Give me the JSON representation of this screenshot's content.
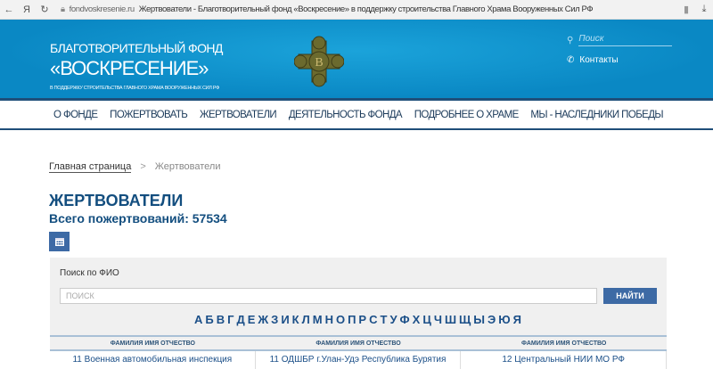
{
  "browser": {
    "back": "←",
    "ya": "Я",
    "reload": "↻",
    "domain": "fondvoskresenie.ru",
    "title": "Жертвователи - Благотворительный фонд «Воскресение» в поддержку строительства Главного Храма Вооруженных Сил РФ"
  },
  "header": {
    "line1": "БЛАГОТВОРИТЕЛЬНЫЙ ФОНД",
    "line2": "«ВОСКРЕСЕНИЕ»",
    "line3": "В ПОДДЕРЖКУ СТРОИТЕЛЬСТВА ГЛАВНОГО ХРАМА ВООРУЖЕННЫХ СИЛ РФ",
    "emblem_letter": "В",
    "search_placeholder": "Поиск",
    "contacts": "Контакты"
  },
  "nav": [
    "О ФОНДЕ",
    "ПОЖЕРТВОВАТЬ",
    "ЖЕРТВОВАТЕЛИ",
    "ДЕЯТЕЛЬНОСТЬ ФОНДА",
    "ПОДРОБНЕЕ О ХРАМЕ",
    "МЫ - НАСЛЕДНИКИ ПОБЕДЫ"
  ],
  "breadcrumb": {
    "home": "Главная страница",
    "sep": ">",
    "current": "Жертвователи"
  },
  "page": {
    "title": "ЖЕРТВОВАТЕЛИ",
    "total": "Всего пожертвований: 57534"
  },
  "search": {
    "label": "Поиск по ФИО",
    "placeholder": "ПОИСК",
    "button": "НАЙТИ"
  },
  "letters": [
    "А",
    "Б",
    "В",
    "Г",
    "Д",
    "Е",
    "Ж",
    "З",
    "И",
    "К",
    "Л",
    "М",
    "Н",
    "О",
    "П",
    "Р",
    "С",
    "Т",
    "У",
    "Ф",
    "Х",
    "Ц",
    "Ч",
    "Ш",
    "Щ",
    "Ы",
    "Э",
    "Ю",
    "Я"
  ],
  "table": {
    "headers": [
      "ФАМИЛИЯ ИМЯ ОТЧЕСТВО",
      "ФАМИЛИЯ ИМЯ ОТЧЕСТВО",
      "ФАМИЛИЯ ИМЯ ОТЧЕСТВО"
    ],
    "rows": [
      [
        "11 Военная автомобильная инспекция",
        "11 ОДШБР г.Улан-Удэ Республика Бурятия",
        "12 Центральный НИИ МО РФ"
      ]
    ]
  }
}
